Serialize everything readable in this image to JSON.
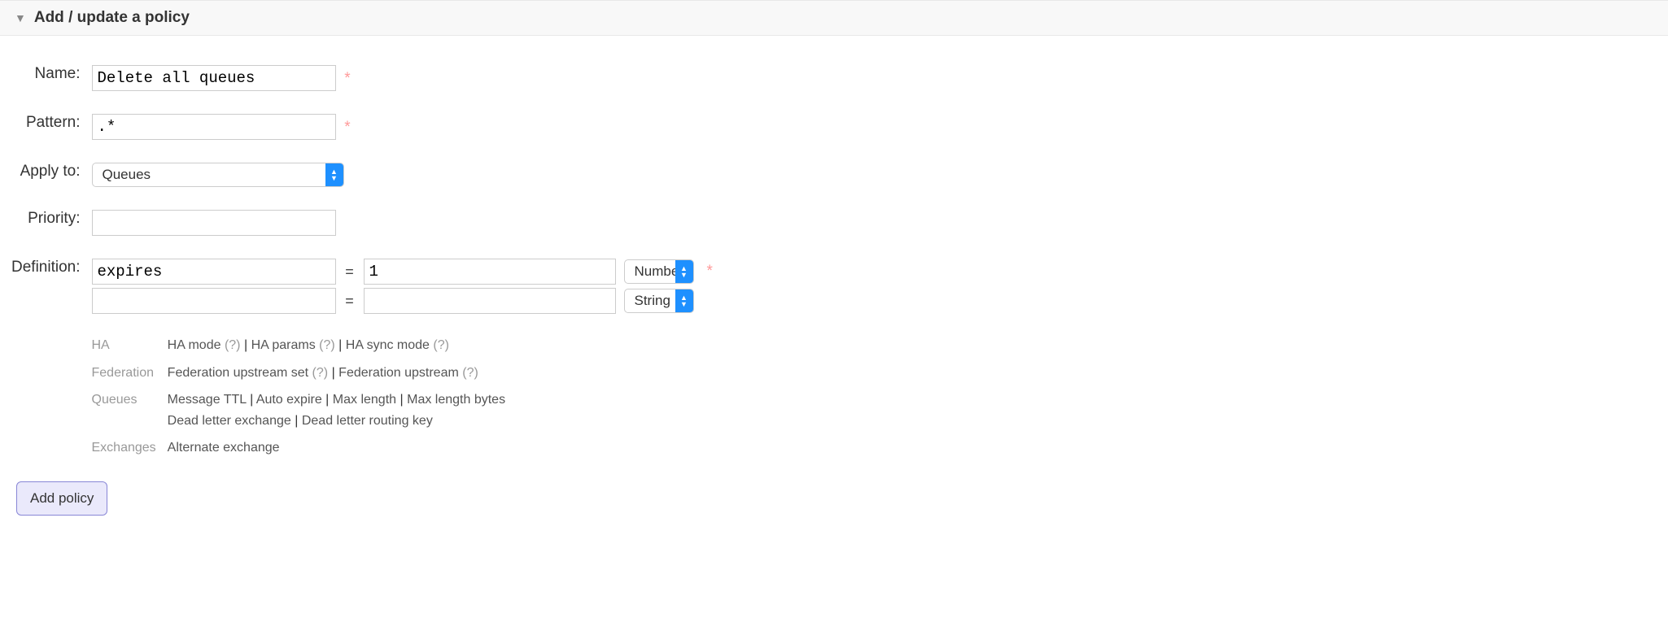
{
  "header": {
    "title": "Add / update a policy"
  },
  "form": {
    "labels": {
      "name": "Name:",
      "pattern": "Pattern:",
      "apply_to": "Apply to:",
      "priority": "Priority:",
      "definition": "Definition:"
    },
    "values": {
      "name": "Delete all queues",
      "pattern": ".*",
      "apply_to": "Queues",
      "priority": "",
      "definitions": [
        {
          "key": "expires",
          "value": "1",
          "type": "Numbe"
        },
        {
          "key": "",
          "value": "",
          "type": "String"
        }
      ]
    },
    "equals": "=",
    "mandatory_mark": "*"
  },
  "hints": {
    "categories": {
      "ha": "HA",
      "federation": "Federation",
      "queues": "Queues",
      "exchanges": "Exchanges"
    },
    "ha": {
      "mode": "HA mode",
      "params": "HA params",
      "sync": "HA sync mode",
      "q": "(?)"
    },
    "federation": {
      "upstream_set": "Federation upstream set",
      "upstream": "Federation upstream",
      "q": "(?)"
    },
    "queues": {
      "ttl": "Message TTL",
      "auto_expire": "Auto expire",
      "max_length": "Max length",
      "max_length_bytes": "Max length bytes",
      "dlx": "Dead letter exchange",
      "dlrk": "Dead letter routing key"
    },
    "exchanges": {
      "alternate": "Alternate exchange"
    },
    "sep": " | "
  },
  "submit": {
    "label": "Add policy"
  }
}
